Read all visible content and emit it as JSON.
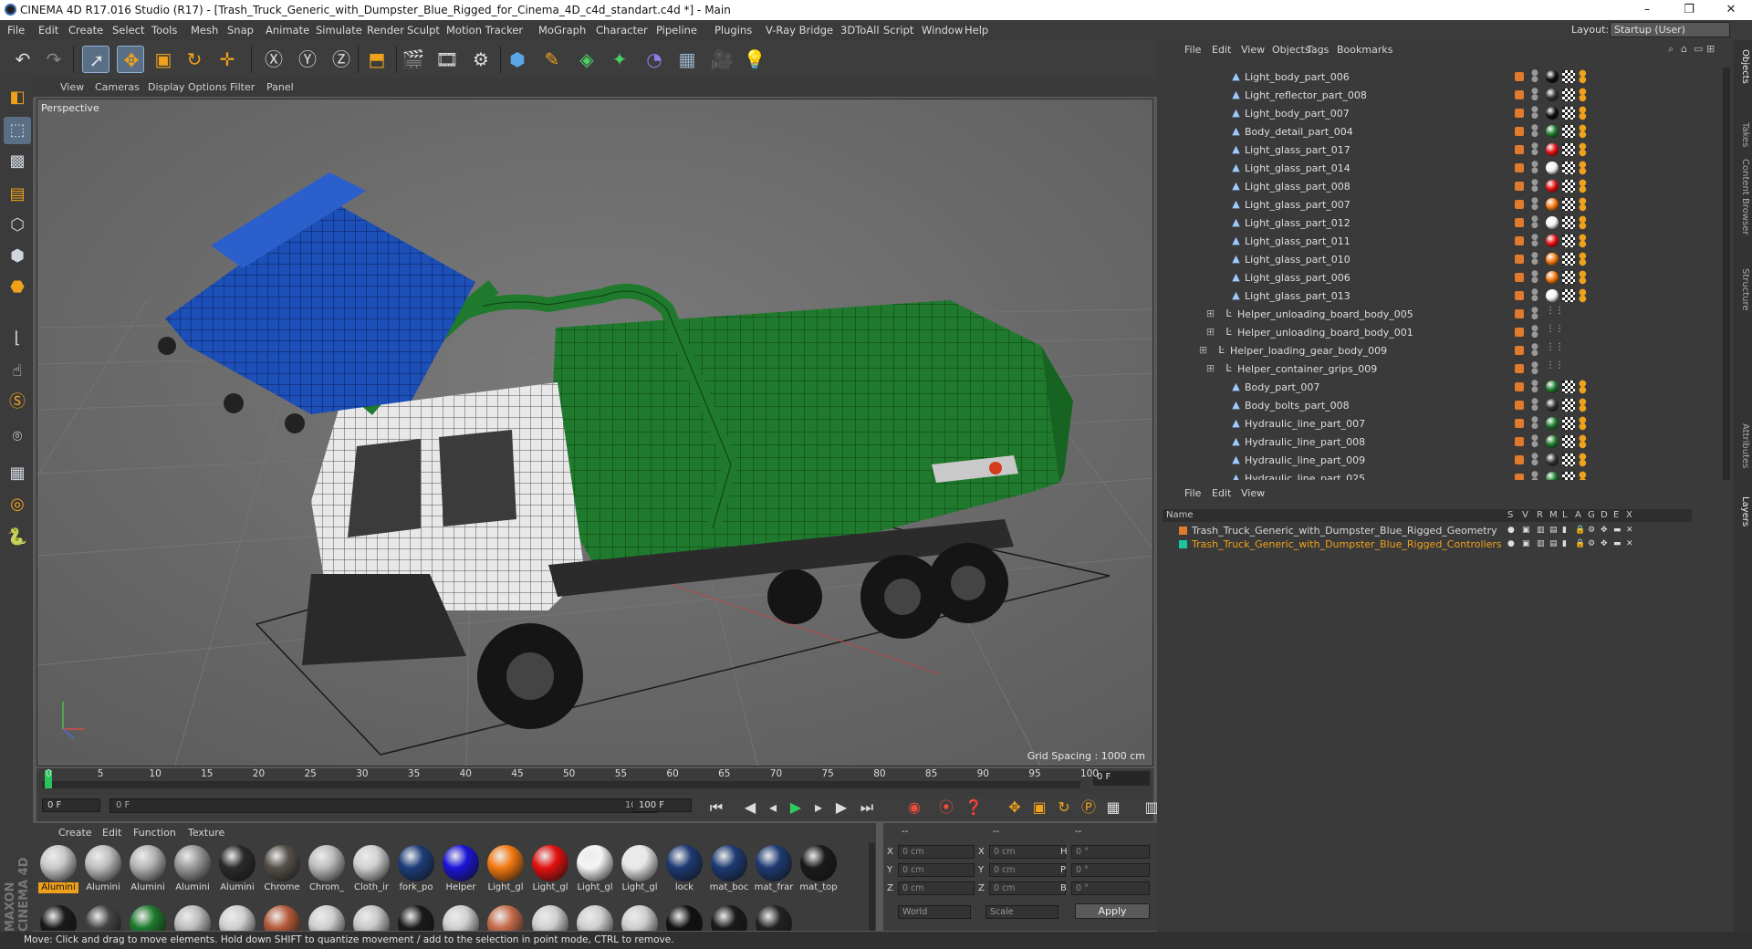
{
  "app": {
    "title": "CINEMA 4D R17.016 Studio (R17) - [Trash_Truck_Generic_with_Dumpster_Blue_Rigged_for_Cinema_4D_c4d_standart.c4d *] - Main",
    "window_controls": [
      "–",
      "❐",
      "✕"
    ]
  },
  "menu": {
    "items": [
      "File",
      "Edit",
      "Create",
      "Select",
      "Tools",
      "Mesh",
      "Snap",
      "Animate",
      "Simulate",
      "Render",
      "Sculpt",
      "Motion Tracker",
      "MoGraph",
      "Character",
      "Pipeline",
      "Plugins",
      "V-Ray Bridge",
      "3DToAll",
      "Script",
      "Window",
      "Help"
    ],
    "layout_label": "Layout:",
    "layout_value": "Startup (User)"
  },
  "toolbar": {
    "icons": [
      "undo-icon",
      "redo-icon",
      "live-selection-icon",
      "move-icon",
      "scale-icon",
      "rotate-icon",
      "recent-tool-icon",
      "x-axis-icon",
      "y-axis-icon",
      "z-axis-icon",
      "coordinate-system-icon",
      "render-view-icon",
      "render-picture-viewer-icon",
      "render-settings-icon",
      "cube-primitive-icon",
      "spline-pen-icon",
      "nurbs-icon",
      "array-icon",
      "deformer-icon",
      "floor-icon",
      "camera-icon",
      "light-icon"
    ]
  },
  "viewport": {
    "menu": [
      "View",
      "Cameras",
      "Display",
      "Options",
      "Filter",
      "Panel"
    ],
    "label": "Perspective",
    "grid_spacing": "Grid Spacing : 1000 cm"
  },
  "timeline": {
    "ticks": [
      "0",
      "5",
      "10",
      "15",
      "20",
      "25",
      "30",
      "35",
      "40",
      "45",
      "50",
      "55",
      "60",
      "65",
      "70",
      "75",
      "80",
      "85",
      "90",
      "95",
      "100"
    ],
    "frame_field": "0 F",
    "start_field": "0 F",
    "range_start": "0 F",
    "range_end": "100 F",
    "end_field": "100 F"
  },
  "materials": {
    "menu": [
      "Create",
      "Edit",
      "Function",
      "Texture"
    ],
    "row1": [
      {
        "label": "Alumini",
        "color": "#c9c9c9",
        "selected": true
      },
      {
        "label": "Alumini",
        "color": "#bfbfbf"
      },
      {
        "label": "Alumini",
        "color": "#b5b5b5"
      },
      {
        "label": "Alumini",
        "color": "#9a9a9a"
      },
      {
        "label": "Alumini",
        "color": "#2a2a2a"
      },
      {
        "label": "Chrome",
        "color": "#555048"
      },
      {
        "label": "Chrom_",
        "color": "#bdbdbd"
      },
      {
        "label": "Cloth_ir",
        "color": "#d0d0d0"
      },
      {
        "label": "fork_po",
        "color": "#1d3d7a"
      },
      {
        "label": "Helper",
        "color": "#1a14d8"
      },
      {
        "label": "Light_gl",
        "color": "#f47a10"
      },
      {
        "label": "Light_gl",
        "color": "#e31010"
      },
      {
        "label": "Light_gl",
        "color": "#f4f4f4"
      },
      {
        "label": "Light_gl",
        "color": "#e8e8e8"
      },
      {
        "label": "lock",
        "color": "#1e3a73"
      },
      {
        "label": "mat_boc",
        "color": "#1e3a73"
      },
      {
        "label": "mat_frar",
        "color": "#1e3a73"
      },
      {
        "label": "mat_top",
        "color": "#1a1a1a"
      }
    ],
    "row2_colors": [
      "#1a1a1a",
      "#444",
      "#1d7a2c",
      "#bdbdbd",
      "#d0d0d0",
      "#b55a3a",
      "#cfcfcf",
      "#c8c8c8",
      "#1a1a1a",
      "#cfcfcf",
      "#c56b4a",
      "#cfcfcf",
      "#cfcfcf",
      "#cfcfcf",
      "#111",
      "#1a1a1a",
      "#222"
    ]
  },
  "coords": {
    "header": [
      "--",
      "--",
      "--"
    ],
    "rows": [
      {
        "a": "X",
        "av": "0 cm",
        "b": "X",
        "bv": "0 cm",
        "c": "H",
        "cv": "0 °"
      },
      {
        "a": "Y",
        "av": "0 cm",
        "b": "Y",
        "bv": "0 cm",
        "c": "P",
        "cv": "0 °"
      },
      {
        "a": "Z",
        "av": "0 cm",
        "b": "Z",
        "bv": "0 cm",
        "c": "B",
        "cv": "0 °"
      }
    ],
    "world": "World",
    "scale": "Scale",
    "apply": "Apply"
  },
  "objects": {
    "menu": [
      "File",
      "Edit",
      "View",
      "Objects",
      "Tags",
      "Bookmarks"
    ],
    "rows": [
      {
        "name": "Light_body_part_006",
        "indent": 2,
        "icon": "poly",
        "tag": "#111"
      },
      {
        "name": "Light_reflector_part_008",
        "indent": 2,
        "icon": "poly",
        "tag": "#333"
      },
      {
        "name": "Light_body_part_007",
        "indent": 2,
        "icon": "poly",
        "tag": "#111"
      },
      {
        "name": "Body_detail_part_004",
        "indent": 2,
        "icon": "poly",
        "tag": "#1f7a2d"
      },
      {
        "name": "Light_glass_part_017",
        "indent": 2,
        "icon": "poly",
        "tag": "#e31010"
      },
      {
        "name": "Light_glass_part_014",
        "indent": 2,
        "icon": "poly",
        "tag": "#f4f4f4"
      },
      {
        "name": "Light_glass_part_008",
        "indent": 2,
        "icon": "poly",
        "tag": "#e31010"
      },
      {
        "name": "Light_glass_part_007",
        "indent": 2,
        "icon": "poly",
        "tag": "#f47a10"
      },
      {
        "name": "Light_glass_part_012",
        "indent": 2,
        "icon": "poly",
        "tag": "#f4f4f4"
      },
      {
        "name": "Light_glass_part_011",
        "indent": 2,
        "icon": "poly",
        "tag": "#e31010"
      },
      {
        "name": "Light_glass_part_010",
        "indent": 2,
        "icon": "poly",
        "tag": "#f47a10"
      },
      {
        "name": "Light_glass_part_006",
        "indent": 2,
        "icon": "poly",
        "tag": "#f47a10"
      },
      {
        "name": "Light_glass_part_013",
        "indent": 2,
        "icon": "poly",
        "tag": "#f4f4f4"
      },
      {
        "name": "Helper_unloading_board_body_005",
        "indent": 1,
        "icon": "null",
        "tag": ""
      },
      {
        "name": "Helper_unloading_board_body_001",
        "indent": 1,
        "icon": "null",
        "tag": ""
      },
      {
        "name": "Helper_loading_gear_body_009",
        "indent": 0,
        "icon": "null",
        "tag": ""
      },
      {
        "name": "Helper_container_grips_009",
        "indent": 1,
        "icon": "null",
        "tag": ""
      },
      {
        "name": "Body_part_007",
        "indent": 2,
        "icon": "poly",
        "tag": "#1f7a2d"
      },
      {
        "name": "Body_bolts_part_008",
        "indent": 2,
        "icon": "poly",
        "tag": "#333"
      },
      {
        "name": "Hydraulic_line_part_007",
        "indent": 2,
        "icon": "poly",
        "tag": "#1f7a2d"
      },
      {
        "name": "Hydraulic_line_part_008",
        "indent": 2,
        "icon": "poly",
        "tag": "#1f7a2d"
      },
      {
        "name": "Hydraulic_line_part_009",
        "indent": 2,
        "icon": "poly",
        "tag": "#333"
      },
      {
        "name": "Hydraulic_line_part_025",
        "indent": 2,
        "icon": "poly",
        "tag": "#1f7a2d"
      }
    ]
  },
  "layers": {
    "menu": [
      "File",
      "Edit",
      "View"
    ],
    "columns": [
      "Name",
      "S",
      "V",
      "R",
      "M",
      "L",
      "A",
      "G",
      "D",
      "E",
      "X"
    ],
    "rows": [
      {
        "name": "Trash_Truck_Generic_with_Dumpster_Blue_Rigged_Geometry",
        "color": "#e07a2c",
        "text_color": "#d8d8d8"
      },
      {
        "name": "Trash_Truck_Generic_with_Dumpster_Blue_Rigged_Controllers",
        "color": "#19c79a",
        "text_color": "#f0a11b"
      }
    ]
  },
  "right_tabs": [
    "Objects",
    "Takes",
    "Content Browser",
    "Structure",
    "Attributes",
    "Layers"
  ],
  "status": "Move: Click and drag to move elements. Hold down SHIFT to quantize movement / add to the selection in point mode, CTRL to remove.",
  "branding": "MAXON CINEMA 4D"
}
